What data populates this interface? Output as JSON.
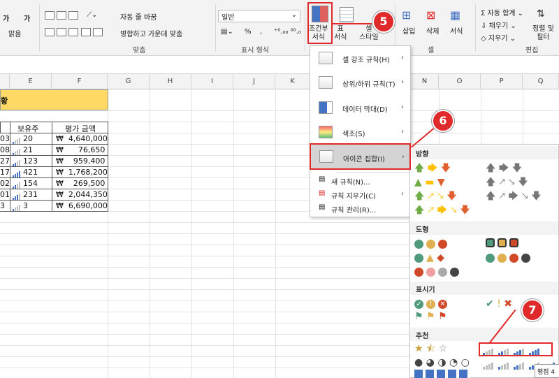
{
  "ribbon": {
    "font_group": {
      "tab_left": "가",
      "tab_left2": "가",
      "label": "맑음"
    },
    "align": {
      "wrap_text": "자동 줄 바꿈",
      "merge_center": "병합하고 가운데 맞춤",
      "group_label": "맞춤"
    },
    "number": {
      "format_value": "일반",
      "percent": "%",
      "comma": ",",
      "group_label": "표시 형식"
    },
    "styles": {
      "conditional": "조건부\n서식",
      "table": "표\n서식",
      "cell_style": "셀\n스타일",
      "group_label": ""
    },
    "cells": {
      "insert": "삽입",
      "delete": "삭제",
      "format": "서식",
      "group_label": "셀"
    },
    "edit": {
      "autosum": "자동 합계",
      "fill": "채우기",
      "clear": "지우기",
      "sort_filter": "정렬 및\n필터",
      "group_label": "편집"
    }
  },
  "columns": [
    "E",
    "F",
    "G",
    "H",
    "I",
    "J",
    "K",
    "N",
    "O",
    "P",
    "Q"
  ],
  "sheet": {
    "title_fragment": "황",
    "headers": {
      "shares": "보유주",
      "valuation": "평가 금액"
    },
    "rows": [
      {
        "left": "03",
        "shares": "20",
        "value": "₩  4,640,000"
      },
      {
        "left": "08",
        "shares": "21",
        "value": "₩      76,650"
      },
      {
        "left": "27",
        "shares": "123",
        "value": "₩    959,400"
      },
      {
        "left": "17",
        "shares": "421",
        "value": "₩  1,768,200"
      },
      {
        "left": "02",
        "shares": "154",
        "value": "₩    269,500"
      },
      {
        "left": "01",
        "shares": "231",
        "value": "₩  2,044,350"
      },
      {
        "left": "3",
        "shares": "3",
        "value": "₩  6,690,000"
      }
    ]
  },
  "menu": {
    "items": [
      {
        "label": "셀 강조 규칙(H)"
      },
      {
        "label": "상위/하위 규칙(T)"
      },
      {
        "label": "데이터 막대(D)"
      },
      {
        "label": "색조(S)"
      },
      {
        "label": "아이콘 집합(I)"
      }
    ],
    "small_items": [
      {
        "label": "새 규칙(N)..."
      },
      {
        "label": "규칙 지우기(C)"
      },
      {
        "label": "규칙 관리(R)..."
      }
    ]
  },
  "submenu": {
    "sections": {
      "direction": "방향",
      "shapes": "도형",
      "indicators": "표시기",
      "ratings": "추천"
    },
    "tooltip": "평점 4"
  },
  "badges": {
    "b5": "5",
    "b6": "6",
    "b7": "7"
  },
  "colors": {
    "accent_red": "#e0292a",
    "header_yellow": "#ffd966",
    "bar_blue": "#4472c4",
    "green": "#70ad47",
    "orange": "#ed7d31",
    "gold": "#ffc000"
  }
}
